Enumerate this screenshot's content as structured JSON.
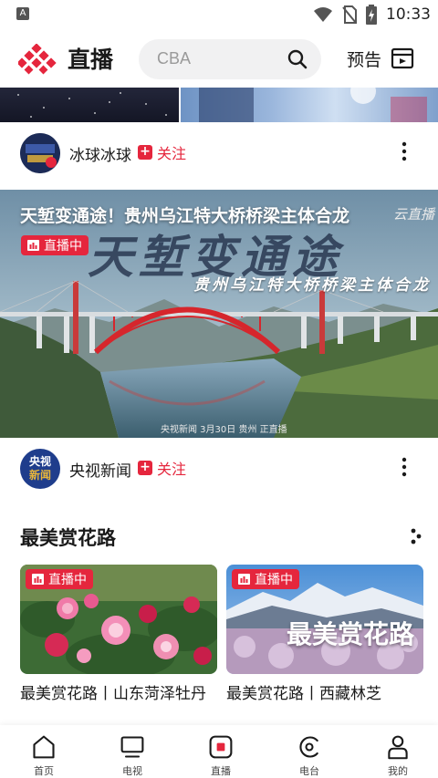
{
  "status_bar": {
    "time": "10:33",
    "left_icon": "A"
  },
  "header": {
    "title": "直播",
    "search_placeholder": "CBA",
    "preview_label": "预告"
  },
  "cards": [
    {
      "channel_name": "冰球冰球",
      "follow_label": "关注"
    },
    {
      "channel_name": "央视新闻",
      "follow_label": "关注",
      "avatar_text_top": "央视",
      "avatar_text_bottom": "新闻",
      "video_title": "天堑变通途！贵州乌江特大桥桥梁主体合龙",
      "live_label": "直播中",
      "overlay_title": "天堑变通途",
      "overlay_subtitle": "贵州乌江特大桥桥梁主体合龙",
      "overlay_corner": "云直播",
      "caption": "央视新闻 3月30日 贵州 正直播"
    }
  ],
  "section": {
    "title": "最美赏花路",
    "items": [
      {
        "live_label": "直播中",
        "title": "最美赏花路丨山东菏泽牡丹"
      },
      {
        "live_label": "直播中",
        "title": "最美赏花路丨西藏林芝",
        "overlay_text": "最美赏花路"
      }
    ]
  },
  "bottom_nav": [
    {
      "label": "首页",
      "icon": "home-icon"
    },
    {
      "label": "电视",
      "icon": "tv-icon"
    },
    {
      "label": "直播",
      "icon": "live-icon",
      "active": true
    },
    {
      "label": "电台",
      "icon": "radio-icon"
    },
    {
      "label": "我的",
      "icon": "profile-icon"
    }
  ],
  "colors": {
    "accent_red": "#e5263d",
    "search_bg": "#f1f1f2"
  }
}
